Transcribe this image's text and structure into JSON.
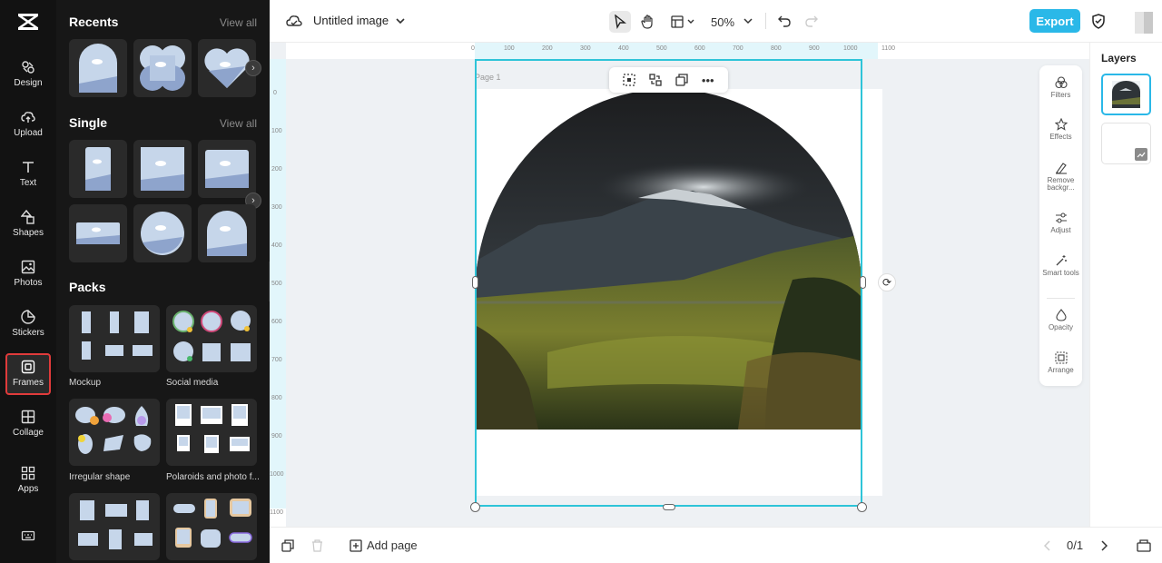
{
  "rail": {
    "items": [
      {
        "label": "Design",
        "icon": "design-icon"
      },
      {
        "label": "Upload",
        "icon": "upload-icon"
      },
      {
        "label": "Text",
        "icon": "text-icon"
      },
      {
        "label": "Shapes",
        "icon": "shapes-icon"
      },
      {
        "label": "Photos",
        "icon": "photos-icon"
      },
      {
        "label": "Stickers",
        "icon": "stickers-icon"
      },
      {
        "label": "Frames",
        "icon": "frames-icon",
        "active": true
      },
      {
        "label": "Collage",
        "icon": "collage-icon"
      },
      {
        "label": "Apps",
        "icon": "apps-icon"
      }
    ]
  },
  "panel": {
    "recents_title": "Recents",
    "single_title": "Single",
    "packs_title": "Packs",
    "view_all": "View all",
    "packs": [
      {
        "label": "Mockup"
      },
      {
        "label": "Social media"
      },
      {
        "label": "Irregular shape"
      },
      {
        "label": "Polaroids and photo f..."
      }
    ]
  },
  "topbar": {
    "doc_title": "Untitled image",
    "zoom": "50%",
    "export_label": "Export"
  },
  "canvas": {
    "page_label": "Page 1",
    "ruler_top": [
      "0",
      "100",
      "200",
      "300",
      "400",
      "500",
      "600",
      "700",
      "800",
      "900",
      "1000",
      "1100"
    ],
    "ruler_left": [
      "0",
      "100",
      "200",
      "300",
      "400",
      "500",
      "600",
      "700",
      "800",
      "900",
      "1000",
      "1100"
    ]
  },
  "tools": {
    "filters": "Filters",
    "effects": "Effects",
    "remove_bg": "Remove backgr...",
    "adjust": "Adjust",
    "smart_tools": "Smart tools",
    "opacity": "Opacity",
    "arrange": "Arrange"
  },
  "layers": {
    "title": "Layers"
  },
  "bottombar": {
    "add_page": "Add page",
    "page_count": "0/1"
  },
  "colors": {
    "accent": "#2ab8e8",
    "selection": "#2ec4d8",
    "active_rail": "#e03b3b"
  }
}
